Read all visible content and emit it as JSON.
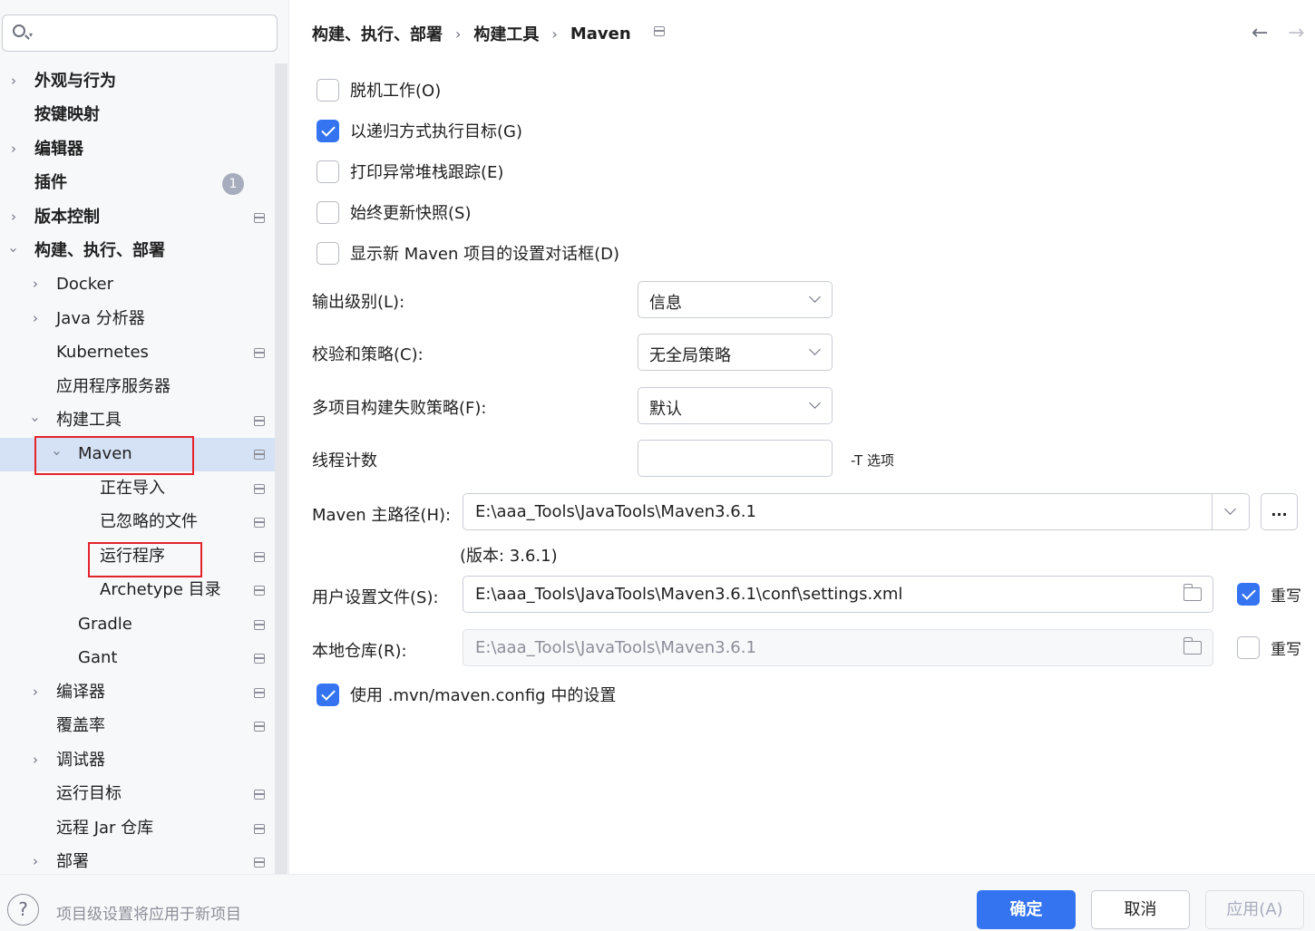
{
  "search": {
    "placeholder": ""
  },
  "sidebar": {
    "badge_plugins": "1",
    "items": [
      {
        "label": "外观与行为"
      },
      {
        "label": "按键映射"
      },
      {
        "label": "编辑器"
      },
      {
        "label": "插件"
      },
      {
        "label": "版本控制"
      },
      {
        "label": "构建、执行、部署"
      },
      {
        "label": "Docker"
      },
      {
        "label": "Java 分析器"
      },
      {
        "label": "Kubernetes"
      },
      {
        "label": "应用程序服务器"
      },
      {
        "label": "构建工具"
      },
      {
        "label": "Maven"
      },
      {
        "label": "正在导入"
      },
      {
        "label": "已忽略的文件"
      },
      {
        "label": "运行程序"
      },
      {
        "label": "Archetype 目录"
      },
      {
        "label": "Gradle"
      },
      {
        "label": "Gant"
      },
      {
        "label": "编译器"
      },
      {
        "label": "覆盖率"
      },
      {
        "label": "调试器"
      },
      {
        "label": "运行目标"
      },
      {
        "label": "远程 Jar 仓库"
      },
      {
        "label": "部署"
      }
    ]
  },
  "breadcrumb": {
    "part1": "构建、执行、部署",
    "part2": "构建工具",
    "part3": "Maven",
    "sep": "›"
  },
  "nav": {
    "back": "←",
    "forward": "→"
  },
  "options": {
    "offline": "脱机工作(O)",
    "recursive": "以递归方式执行目标(G)",
    "print_stack": "打印异常堆栈跟踪(E)",
    "update_snapshots": "始终更新快照(S)",
    "show_dialog": "显示新 Maven 项目的设置对话框(D)",
    "use_mvn_config": "使用 .mvn/maven.config 中的设置"
  },
  "form": {
    "output_level_label": "输出级别(L):",
    "output_level_value": "信息",
    "checksum_label": "校验和策略(C):",
    "checksum_value": "无全局策略",
    "fail_policy_label": "多项目构建失败策略(F):",
    "fail_policy_value": "默认",
    "thread_label": "线程计数",
    "thread_value": "",
    "thread_hint": "-T 选项",
    "maven_home_label": "Maven 主路径(H):",
    "maven_home_value": "E:\\aaa_Tools\\JavaTools\\Maven3.6.1",
    "ellipsis": "...",
    "version": "(版本: 3.6.1)",
    "user_settings_label": "用户设置文件(S):",
    "user_settings_value": "E:\\aaa_Tools\\JavaTools\\Maven3.6.1\\conf\\settings.xml",
    "override_label": "重写",
    "local_repo_label": "本地仓库(R):",
    "local_repo_value": "E:\\aaa_Tools\\JavaTools\\Maven3.6.1"
  },
  "footer": {
    "help": "?",
    "note": "项目级设置将应用于新项目",
    "ok": "确定",
    "cancel": "取消",
    "apply": "应用(A)"
  },
  "colors": {
    "accent": "#3574f0",
    "selection": "#d5e1f5",
    "highlight_box": "#e3242b"
  }
}
